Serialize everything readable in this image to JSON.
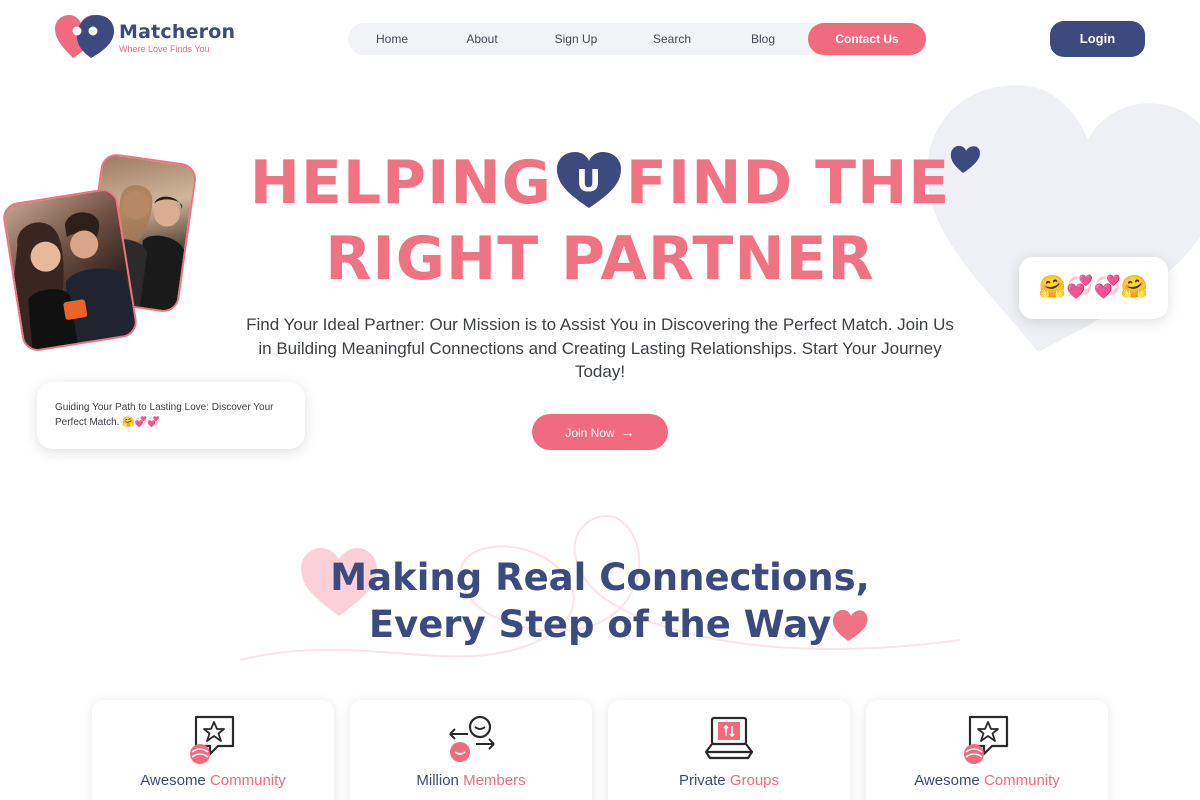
{
  "brand": {
    "name": "Matcheron",
    "tagline": "Where Love Finds You"
  },
  "nav": {
    "items": [
      "Home",
      "About",
      "Sign Up",
      "Search",
      "Blog"
    ],
    "contact_label": "Contact Us",
    "login_label": "Login"
  },
  "hero": {
    "title_part1": "HELPING",
    "title_heart_letter": "U",
    "title_part2": "FIND THE",
    "title_line2": "RIGHT PARTNER",
    "description": "Find Your Ideal Partner: Our Mission is to Assist You in Discovering the Perfect Match. Join Us in Building Meaningful Connections and Creating Lasting Relationships. Start Your Journey Today!",
    "cta_label": "Join Now",
    "quote": "Guiding Your Path to Lasting Love: Discover Your Perfect Match. 🤗💞💞",
    "emoji_row": "🤗💞💞🤗"
  },
  "section": {
    "title_line1": "Making Real Connections,",
    "title_line2": "Every Step of the Way"
  },
  "features": [
    {
      "label_main": "Awesome",
      "label_accent": "Community",
      "icon": "star-chat-icon"
    },
    {
      "label_main": "Million",
      "label_accent": "Members",
      "icon": "members-swap-icon"
    },
    {
      "label_main": "Private",
      "label_accent": "Groups",
      "icon": "laptop-lock-icon"
    },
    {
      "label_main": "Awesome",
      "label_accent": "Community",
      "icon": "star-chat-icon"
    }
  ],
  "colors": {
    "brand_pink": "#f06b7e",
    "brand_navy": "#3c4a7d",
    "nav_bg": "#f1f3f6"
  }
}
